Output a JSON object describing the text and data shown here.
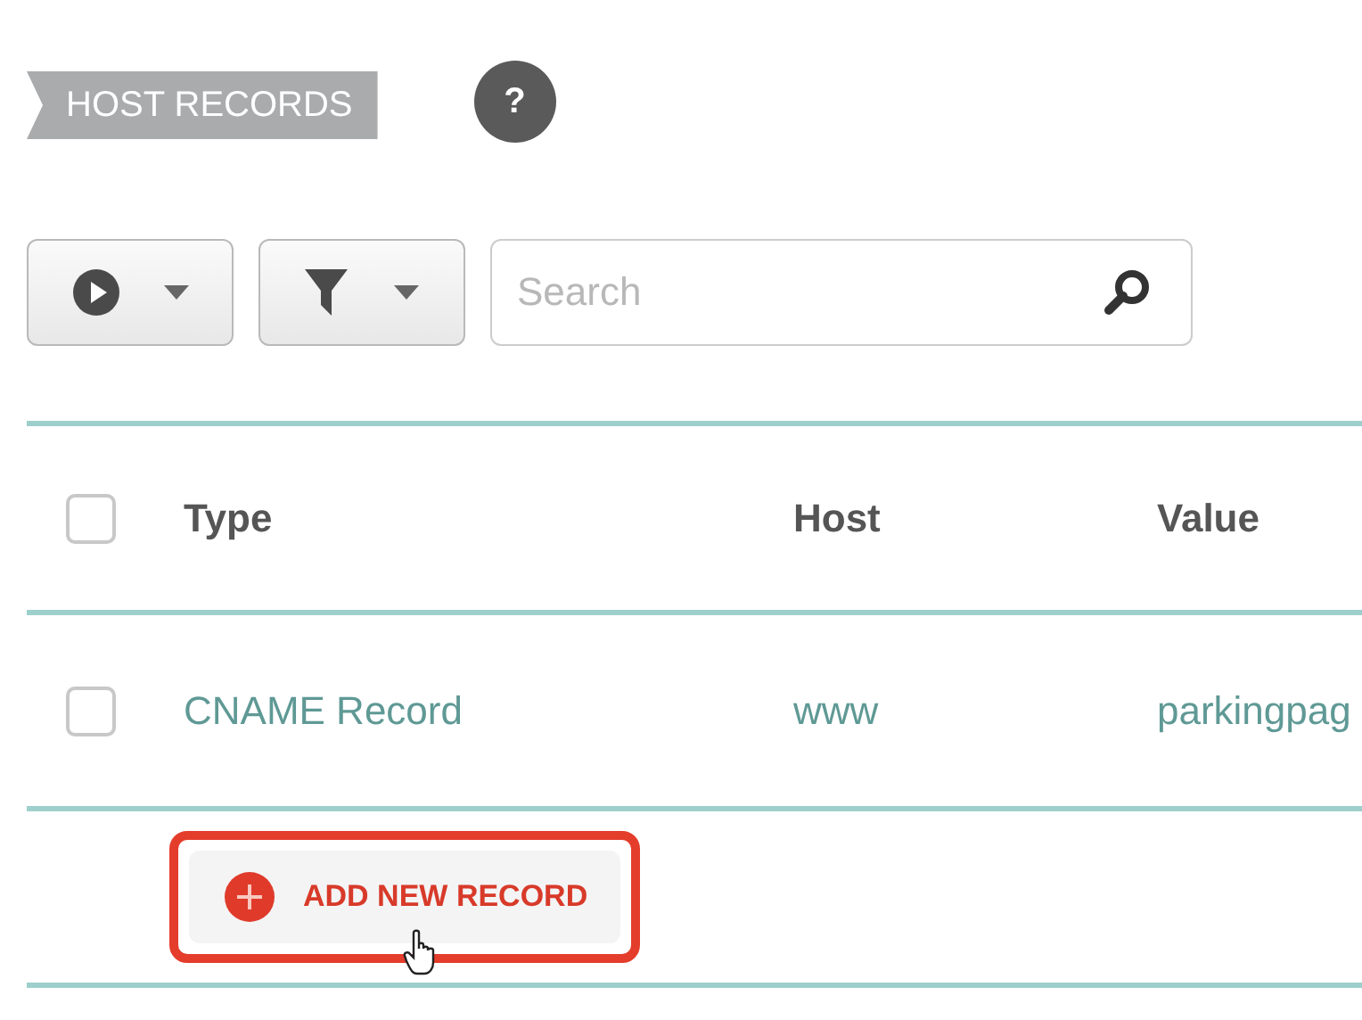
{
  "section_title": "HOST RECORDS",
  "help_button": {
    "label": "?"
  },
  "toolbar": {
    "search": {
      "placeholder": "Search"
    }
  },
  "table": {
    "header_checkbox": {
      "checked": false
    },
    "columns": [
      "Type",
      "Host",
      "Value"
    ],
    "rows": [
      {
        "checked": false,
        "cells": [
          "CNAME Record",
          "www",
          "parkingpag"
        ]
      }
    ]
  },
  "add_button": {
    "label": "ADD NEW RECORD",
    "highlighted": true
  }
}
